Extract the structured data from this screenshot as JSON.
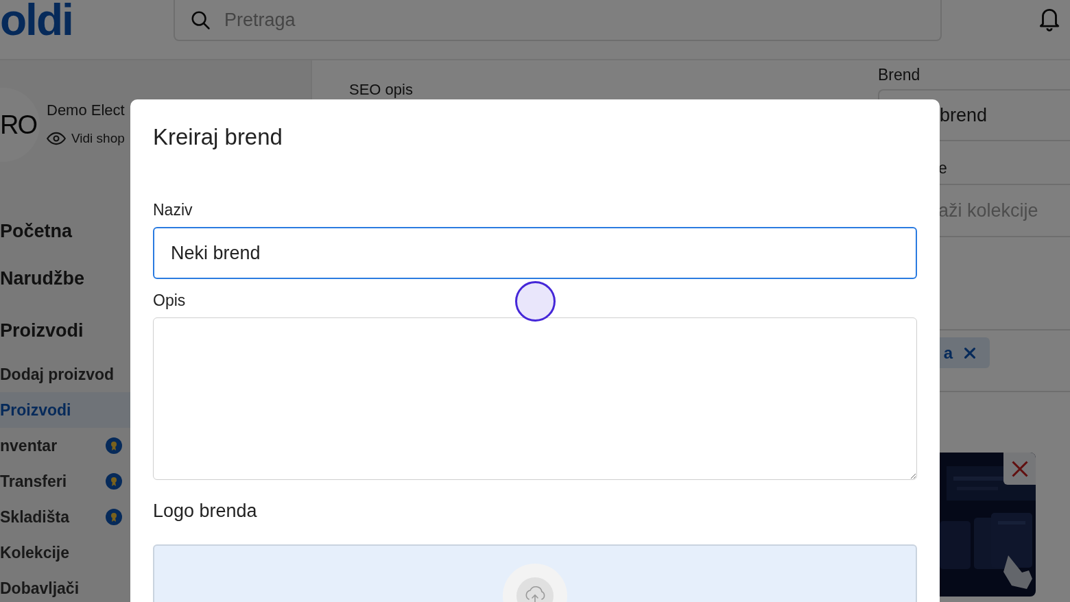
{
  "header": {
    "logo": "oldi",
    "search": {
      "placeholder": "Pretraga"
    }
  },
  "shop": {
    "avatar": "RO",
    "name": "Demo Elect",
    "link": "Vidi shop"
  },
  "sidebar": {
    "items": [
      {
        "label": "Početna",
        "kind": "section",
        "selected": false,
        "badge": false
      },
      {
        "label": "Narudžbe",
        "kind": "section",
        "selected": false,
        "badge": false
      },
      {
        "label": "Proizvodi",
        "kind": "section",
        "selected": false,
        "badge": false
      },
      {
        "label": "Dodaj proizvod",
        "kind": "sub",
        "selected": false,
        "badge": false
      },
      {
        "label": "Proizvodi",
        "kind": "sub",
        "selected": true,
        "badge": false
      },
      {
        "label": "nventar",
        "kind": "sub",
        "selected": false,
        "badge": true
      },
      {
        "label": "Transferi",
        "kind": "sub",
        "selected": false,
        "badge": true
      },
      {
        "label": "Skladišta",
        "kind": "sub",
        "selected": false,
        "badge": true
      },
      {
        "label": "Kolekcije",
        "kind": "sub",
        "selected": false,
        "badge": false
      },
      {
        "label": "Dobavljači",
        "kind": "sub",
        "selected": false,
        "badge": false
      }
    ]
  },
  "main": {
    "label": "SEO opis"
  },
  "side_panel": {
    "brand_label": "Brend",
    "brand_value": "brend",
    "collections_label": "e",
    "collections_placeholder": "aži kolekcije",
    "tag": "a"
  },
  "modal": {
    "title": "Kreiraj brend",
    "fields": [
      {
        "kind": "input",
        "label": "Naziv",
        "value": "Neki brend",
        "focused": true
      },
      {
        "kind": "textarea",
        "label": "Opis",
        "focused": false
      }
    ],
    "logo_section": {
      "label": "Logo brenda"
    }
  }
}
